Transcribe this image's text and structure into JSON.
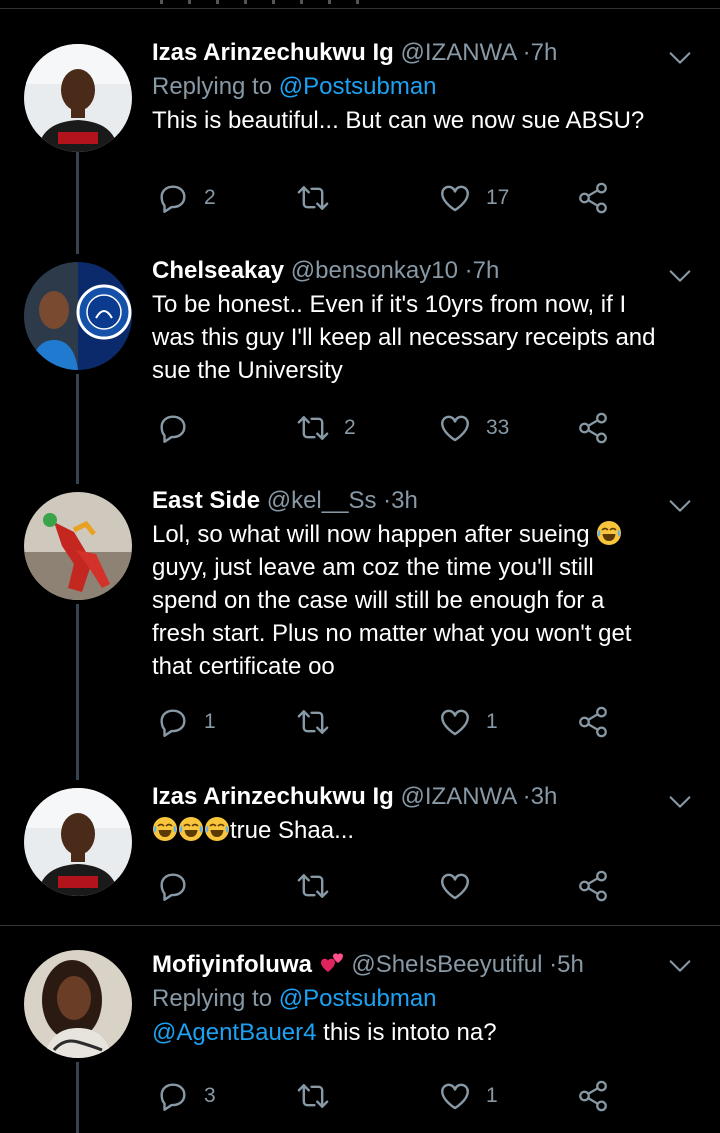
{
  "tweets": [
    {
      "name": "Izas Arinzechukwu Ig",
      "handle": "@IZANWA",
      "time": "7h",
      "replying_label": "Replying to",
      "replying_to": "@Postsubman",
      "text": "This is beautiful... But can we now sue ABSU?",
      "replies": "2",
      "retweets": "",
      "likes": "17"
    },
    {
      "name": "Chelseakay",
      "handle": "@bensonkay10",
      "time": "7h",
      "text": "To be honest.. Even if it's 10yrs from now, if I was this guy I'll keep all necessary receipts and sue the University",
      "replies": "",
      "retweets": "2",
      "likes": "33"
    },
    {
      "name": "East Side",
      "handle": "@kel__Ss",
      "time": "3h",
      "text_part1": "Lol, so what will now happen after sueing",
      "text_part2": "guyy, just leave am coz the time you'll still spend on the case will still be enough for a fresh start. Plus no matter what you won't get that certificate oo",
      "replies": "1",
      "retweets": "",
      "likes": "1"
    },
    {
      "name": "Izas Arinzechukwu Ig",
      "handle": "@IZANWA",
      "time": "3h",
      "text": "true Shaa...",
      "replies": "",
      "retweets": "",
      "likes": ""
    },
    {
      "name": "Mofiyinfoluwa",
      "handle": "@SheIsBeeyutiful",
      "time": "5h",
      "replying_label": "Replying to",
      "replying_to": "@Postsubman",
      "mention": "@AgentBauer4",
      "text": "this is intoto na?",
      "replies": "3",
      "retweets": "",
      "likes": "1"
    }
  ],
  "separator": "·",
  "colors": {
    "background": "#000000",
    "secondary": "#8899a6",
    "link": "#1da1f2",
    "thread_line": "#38444d"
  },
  "icons": [
    "reply-icon",
    "retweet-icon",
    "like-icon",
    "share-icon",
    "caret-down-icon",
    "laughing-emoji-icon",
    "two-hearts-emoji-icon"
  ]
}
